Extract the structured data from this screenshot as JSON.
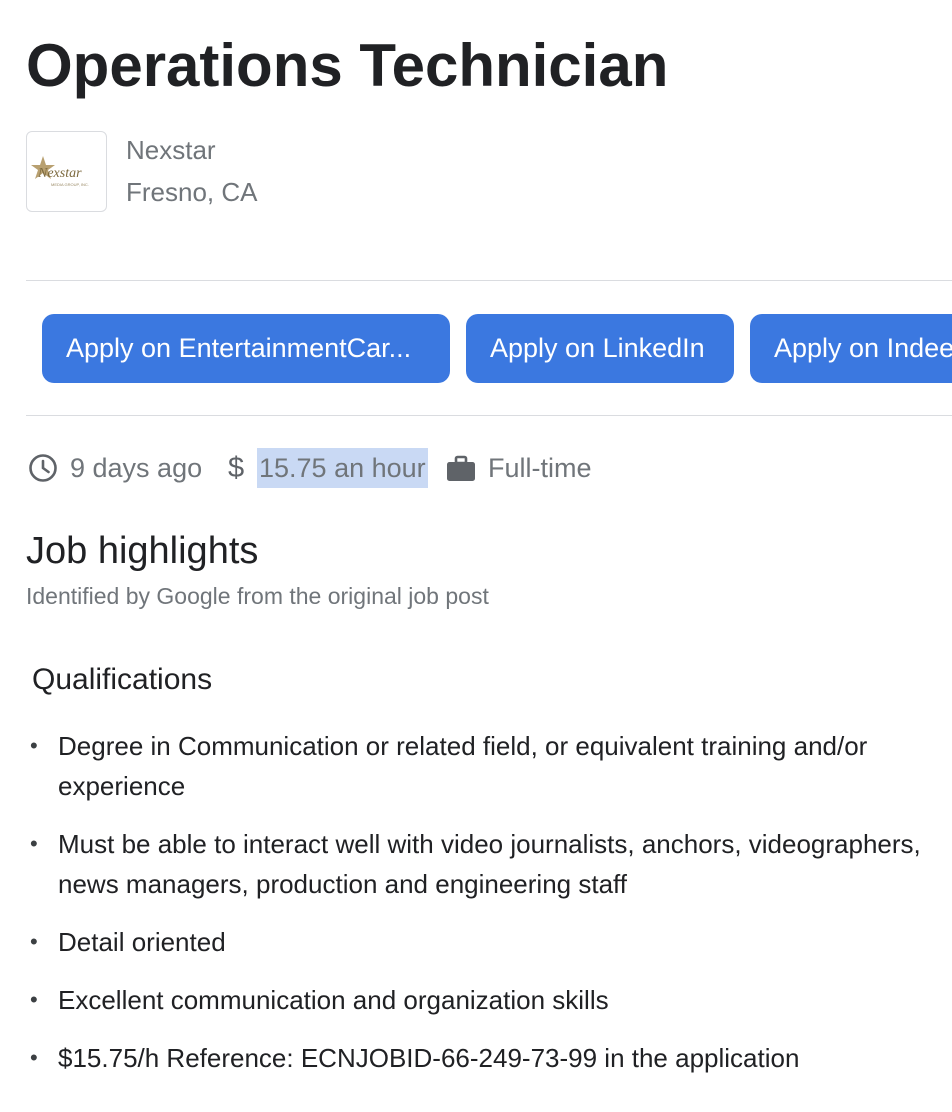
{
  "job": {
    "title": "Operations Technician",
    "company": "Nexstar",
    "location": "Fresno, CA",
    "logo_text": "Nexstar",
    "logo_tagline": "MEDIA GROUP, INC."
  },
  "apply_buttons": [
    {
      "label": "Apply on EntertainmentCar..."
    },
    {
      "label": "Apply on LinkedIn"
    },
    {
      "label": "Apply on Indeed"
    }
  ],
  "meta": {
    "posted": "9 days ago",
    "salary_symbol": "$",
    "salary": "15.75 an hour",
    "job_type": "Full-time"
  },
  "highlights": {
    "heading": "Job highlights",
    "subtitle": "Identified by Google from the original job post",
    "qualifications": {
      "heading": "Qualifications",
      "items": [
        "Degree in Communication or related field, or equivalent training and/or experience",
        "Must be able to interact well with video journalists, anchors, videographers, news managers, production and engineering staff",
        "Detail oriented",
        "Excellent communication and organization skills",
        "$15.75/h Reference: ECNJOBID-66-249-73-99 in the application"
      ]
    }
  },
  "icons": {
    "posted": "clock-icon",
    "salary": "dollar-icon",
    "job_type": "briefcase-icon"
  },
  "colors": {
    "apply_button": "#3b78e0",
    "highlight": "#c9d9f4",
    "secondary_text": "#70757a"
  }
}
